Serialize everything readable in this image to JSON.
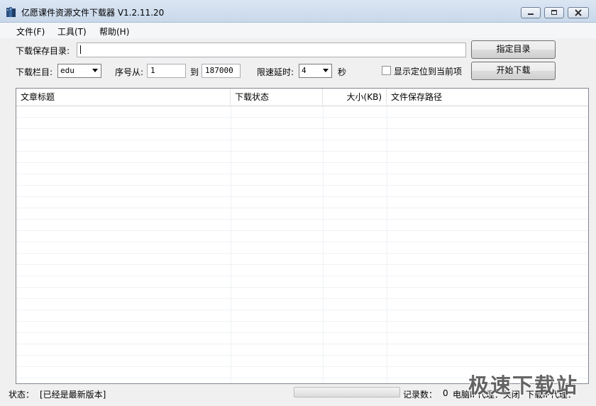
{
  "window": {
    "title": "亿愿课件资源文件下载器 V1.2.11.20",
    "icon": "book-icon"
  },
  "menu": [
    "文件(F)",
    "工具(T)",
    "帮助(H)"
  ],
  "form": {
    "save_dir_label": "下载保存目录:",
    "save_dir_value": "",
    "choose_dir_button": "指定目录",
    "column_label": "下载栏目:",
    "column_value": "edu",
    "seq_from_label": "序号从:",
    "seq_from_value": "1",
    "seq_to_label": "到",
    "seq_to_value": "187000",
    "delay_label": "限速延时:",
    "delay_value": "4",
    "delay_unit": "秒",
    "show_current_label": "显示定位到当前项",
    "show_current_checked": false,
    "start_button": "开始下载"
  },
  "table": {
    "columns": [
      "文章标题",
      "下载状态",
      "大小(KB)",
      "文件保存路径"
    ],
    "rows": []
  },
  "status": {
    "label": "状态：",
    "text": "[已经是最新版本]",
    "progress": 0,
    "records_label": "记录数：",
    "records_value": "0",
    "proxy_text": "电脑IP代理：关闭",
    "download_proxy_text": "下载IP代理："
  },
  "watermark": "极速下载站"
}
